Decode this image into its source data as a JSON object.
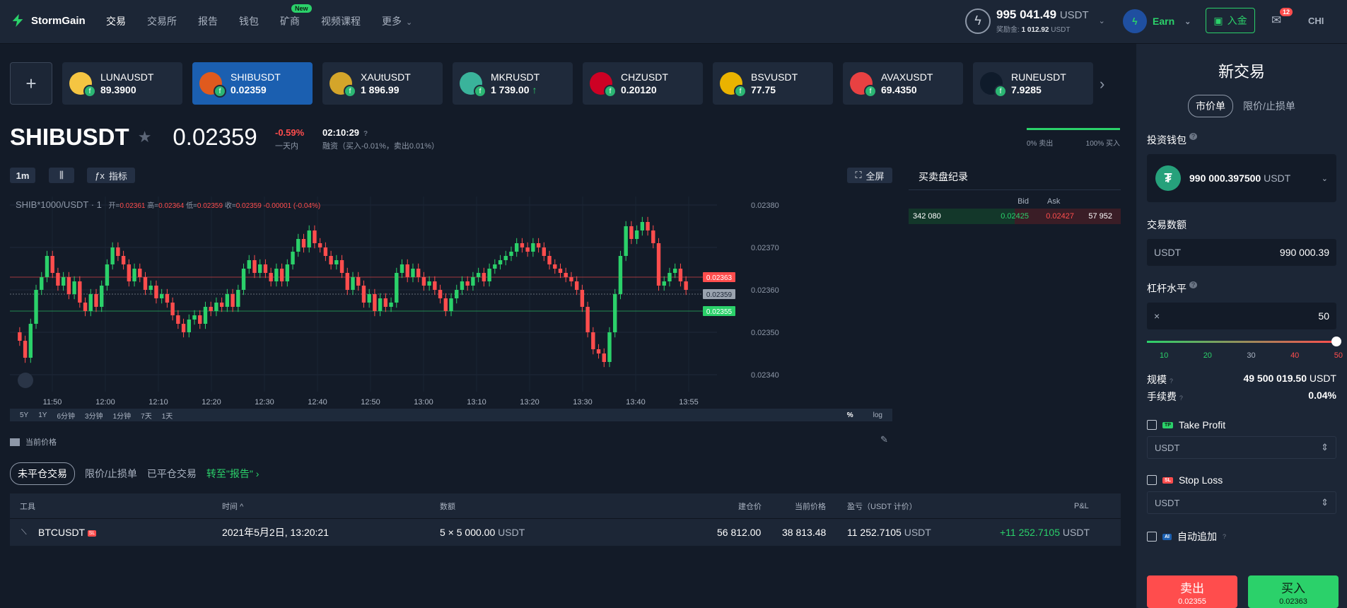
{
  "header": {
    "brand": "StormGain",
    "nav": [
      {
        "label": "交易",
        "active": true
      },
      {
        "label": "交易所"
      },
      {
        "label": "报告"
      },
      {
        "label": "钱包"
      },
      {
        "label": "矿商",
        "badge": "New"
      },
      {
        "label": "视频课程"
      },
      {
        "label": "更多"
      }
    ],
    "balance": {
      "amount": "995 041.49",
      "currency": "USDT",
      "bonus_label": "奖励金:",
      "bonus_amount": "1 012.92",
      "bonus_currency": "USDT"
    },
    "earn_label": "Earn",
    "deposit_label": "入金",
    "notifications": "12",
    "lang": "CHI"
  },
  "tickers": [
    {
      "symbol": "LUNAUSDT",
      "price": "89.3900",
      "color": "#f5c542",
      "icon": "luna-coin-icon"
    },
    {
      "symbol": "SHIBUSDT",
      "price": "0.02359",
      "color": "#e05a1e",
      "active": true,
      "icon": "shib-coin-icon"
    },
    {
      "symbol": "XAUtUSDT",
      "price": "1 896.99",
      "color": "#d4a52a",
      "icon": "gold-coin-icon"
    },
    {
      "symbol": "MKRUSDT",
      "price": "1 739.00",
      "color": "#3ab39b",
      "icon": "mkr-coin-icon",
      "trend": "up"
    },
    {
      "symbol": "CHZUSDT",
      "price": "0.20120",
      "color": "#cd0124",
      "icon": "chz-coin-icon"
    },
    {
      "symbol": "BSVUSDT",
      "price": "77.75",
      "color": "#eab300",
      "icon": "bsv-coin-icon"
    },
    {
      "symbol": "AVAXUSDT",
      "price": "69.4350",
      "color": "#e84142",
      "icon": "avax-coin-icon"
    },
    {
      "symbol": "RUNEUSDT",
      "price": "7.9285",
      "color": "#0f1b2b",
      "icon": "rune-coin-icon"
    }
  ],
  "instrument": {
    "name": "SHIBUSDT",
    "price": "0.02359",
    "change": "-0.59%",
    "change_label": "一天内",
    "funding_time": "02:10:29",
    "funding_text": "融资（买入-0.01%，卖出0.01%）",
    "sell_pct_label": "0% 卖出",
    "buy_pct_label": "100% 买入",
    "buy_share": 1.0
  },
  "chart_controls": {
    "interval": "1m",
    "indicators": "指标",
    "fullscreen": "全屏"
  },
  "chart_legend": {
    "series": "SHIB*1000/USDT · 1",
    "o_label": "开=",
    "o": "0.02361",
    "h_label": "高=",
    "h": "0.02364",
    "l_label": "低=",
    "l": "0.02359",
    "c_label": "收=",
    "c": "0.02359",
    "chg": "-0.00001 (-0.04%)"
  },
  "chart_data": {
    "type": "candlestick",
    "title": "SHIB*1000/USDT · 1",
    "x_ticks": [
      "11:50",
      "12:00",
      "12:10",
      "12:20",
      "12:30",
      "12:40",
      "12:50",
      "13:00",
      "13:10",
      "13:20",
      "13:30",
      "13:40",
      "13:55"
    ],
    "y_ticks": [
      "0.02380",
      "0.02370",
      "0.02360",
      "0.02350",
      "0.02340"
    ],
    "ylim": [
      0.02336,
      0.02382
    ],
    "price_labels": {
      "ask": "0.02363",
      "last": "0.02359",
      "bid": "0.02355"
    },
    "closes": [
      0.02348,
      0.02344,
      0.02352,
      0.0236,
      0.02363,
      0.02368,
      0.02364,
      0.02361,
      0.02363,
      0.02359,
      0.02362,
      0.02357,
      0.02355,
      0.02359,
      0.02356,
      0.02361,
      0.02366,
      0.0237,
      0.02368,
      0.02366,
      0.02362,
      0.02365,
      0.02363,
      0.0236,
      0.02361,
      0.02358,
      0.02359,
      0.02357,
      0.02354,
      0.02352,
      0.0235,
      0.02353,
      0.02354,
      0.02352,
      0.02356,
      0.02355,
      0.02357,
      0.02356,
      0.02359,
      0.02356,
      0.0236,
      0.02365,
      0.02367,
      0.02364,
      0.02366,
      0.02364,
      0.02362,
      0.02365,
      0.02362,
      0.02366,
      0.02369,
      0.02372,
      0.0237,
      0.02374,
      0.02371,
      0.0237,
      0.02368,
      0.02366,
      0.02367,
      0.02364,
      0.0236,
      0.02363,
      0.02361,
      0.02357,
      0.02359,
      0.02355,
      0.02358,
      0.02356,
      0.02357,
      0.02364,
      0.02366,
      0.02363,
      0.02365,
      0.02363,
      0.02361,
      0.02362,
      0.0236,
      0.02358,
      0.02355,
      0.02358,
      0.0236,
      0.02362,
      0.02361,
      0.02363,
      0.02364,
      0.02362,
      0.02365,
      0.02366,
      0.02367,
      0.02368,
      0.02369,
      0.02371,
      0.0237,
      0.02369,
      0.02371,
      0.0237,
      0.02368,
      0.02366,
      0.02365,
      0.02364,
      0.02363,
      0.02362,
      0.0236,
      0.02356,
      0.0235,
      0.02346,
      0.02345,
      0.02343,
      0.0235,
      0.02359,
      0.02368,
      0.02375,
      0.02372,
      0.02374,
      0.02376,
      0.02374,
      0.02371,
      0.02361,
      0.02362,
      0.02364,
      0.02365,
      0.02362,
      0.0236
    ]
  },
  "range_bar": {
    "periods": [
      "5Y",
      "1Y",
      "6分钟",
      "3分钟",
      "1分钟",
      "7天",
      "1天"
    ],
    "pct": "%",
    "log": "log"
  },
  "current_price_label": "当前价格",
  "orderbook": {
    "title": "买卖盘纪录",
    "bid_h": "Bid",
    "ask_h": "Ask",
    "bid_vol": "342 080",
    "bid": "0.02425",
    "ask": "0.02427",
    "ask_vol": "57 952"
  },
  "positions": {
    "tabs": [
      "未平仓交易",
      "限价/止损单",
      "已平仓交易"
    ],
    "report_link": "转至\"报告\" ›",
    "headers": [
      "工具",
      "时间",
      "数额",
      "建仓价",
      "当前价格",
      "盈亏（USDT 计价）",
      "P&L"
    ],
    "rows": [
      {
        "instrument": "BTCUSDT",
        "time": "2021年5月2日, 13:20:21",
        "amount": "5 × 5 000.00",
        "amount_ccy": "USDT",
        "open": "56 812.00",
        "current": "38 813.48",
        "pnl": "11 252.7105",
        "pnl_ccy": "USDT",
        "pl": "+11 252.7105",
        "pl_ccy": "USDT",
        "sl_tag": "SL"
      }
    ]
  },
  "panel": {
    "title": "新交易",
    "order_types": [
      "市价单",
      "限价/止损单"
    ],
    "wallet_label": "投资钱包",
    "wallet_value": "990 000.397500",
    "wallet_ccy": "USDT",
    "amount_label": "交易数额",
    "amount_ccy": "USDT",
    "amount_value": "990 000.39",
    "leverage_label": "杠杆水平",
    "leverage_prefix": "×",
    "leverage_value": "50",
    "leverage_fraction": 1.0,
    "leverage_ticks": [
      "10",
      "20",
      "30",
      "40",
      "50"
    ],
    "size_label": "规模",
    "size_value": "49 500 019.50",
    "size_ccy": "USDT",
    "fee_label": "手续费",
    "fee_value": "0.04%",
    "tp_label": "Take Profit",
    "tp_tag": "TP",
    "sl_label": "Stop Loss",
    "sl_tag": "SL",
    "field_ccy": "USDT",
    "auto_label": "自动追加",
    "auto_tag": "AI",
    "sell_label": "卖出",
    "sell_price": "0.02355",
    "buy_label": "买入",
    "buy_price": "0.02363",
    "colors": {
      "buy": "#2bd16a",
      "sell": "#ff4d4d",
      "accent": "#1b5fb0"
    }
  }
}
